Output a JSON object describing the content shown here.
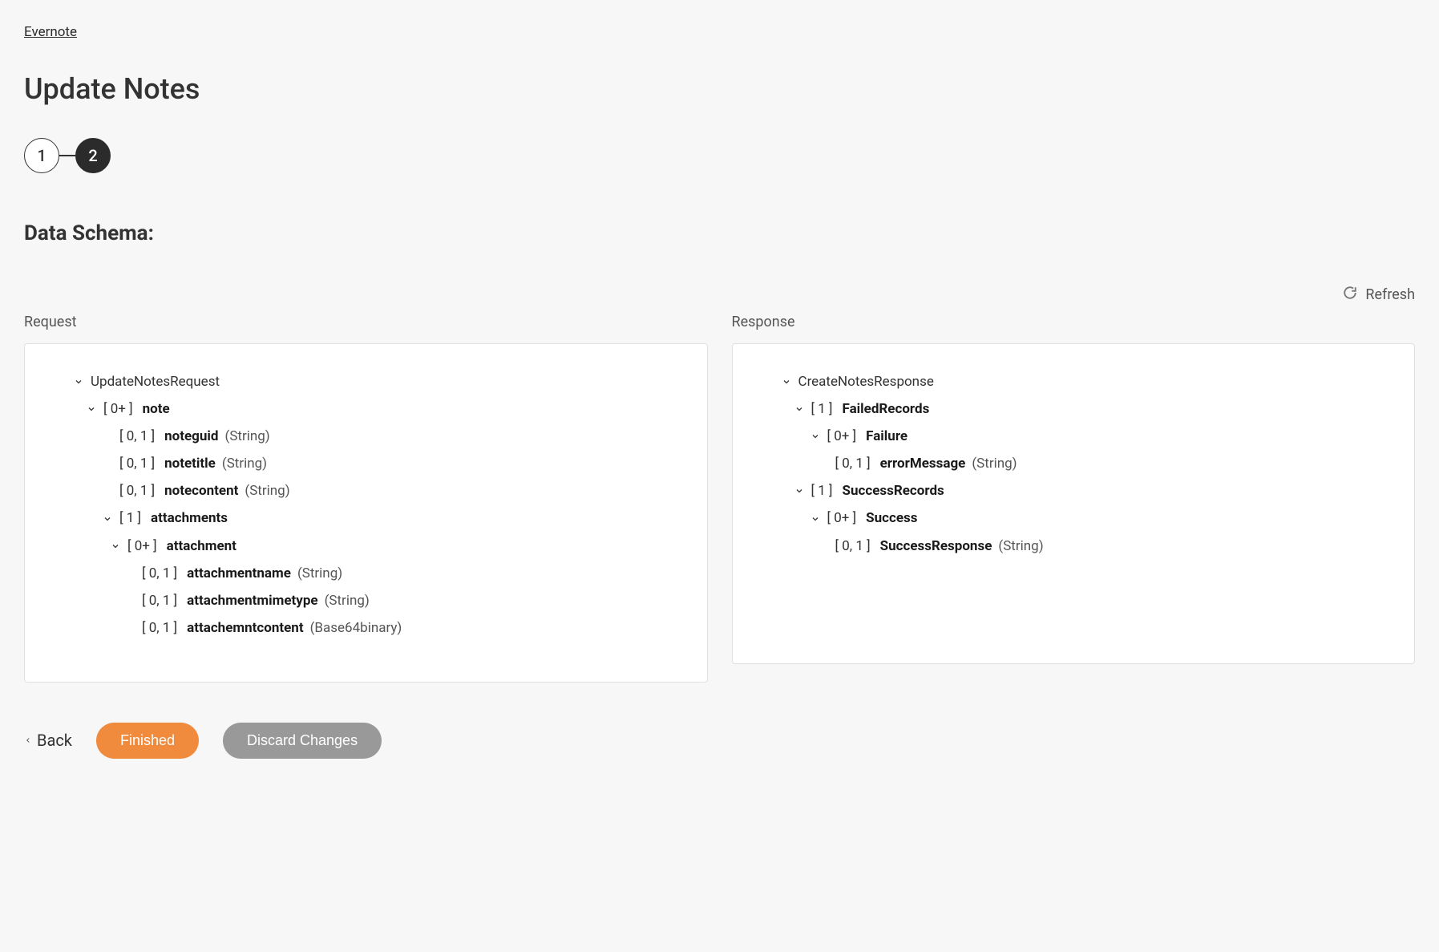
{
  "breadcrumb": "Evernote",
  "page_title": "Update Notes",
  "stepper": {
    "step1": "1",
    "step2": "2"
  },
  "section_title": "Data Schema:",
  "refresh_label": "Refresh",
  "request": {
    "label": "Request",
    "root": "UpdateNotesRequest",
    "note_card": "[ 0+ ]",
    "note_name": "note",
    "noteguid_card": "[ 0, 1 ]",
    "noteguid_name": "noteguid",
    "noteguid_type": "(String)",
    "notetitle_card": "[ 0, 1 ]",
    "notetitle_name": "notetitle",
    "notetitle_type": "(String)",
    "notecontent_card": "[ 0, 1 ]",
    "notecontent_name": "notecontent",
    "notecontent_type": "(String)",
    "attachments_card": "[ 1 ]",
    "attachments_name": "attachments",
    "attachment_card": "[ 0+ ]",
    "attachment_name": "attachment",
    "attachmentname_card": "[ 0, 1 ]",
    "attachmentname_name": "attachmentname",
    "attachmentname_type": "(String)",
    "attachmentmimetype_card": "[ 0, 1 ]",
    "attachmentmimetype_name": "attachmentmimetype",
    "attachmentmimetype_type": "(String)",
    "attachemntcontent_card": "[ 0, 1 ]",
    "attachemntcontent_name": "attachemntcontent",
    "attachemntcontent_type": "(Base64binary)"
  },
  "response": {
    "label": "Response",
    "root": "CreateNotesResponse",
    "failedrecords_card": "[ 1 ]",
    "failedrecords_name": "FailedRecords",
    "failure_card": "[ 0+ ]",
    "failure_name": "Failure",
    "errormessage_card": "[ 0, 1 ]",
    "errormessage_name": "errorMessage",
    "errormessage_type": "(String)",
    "successrecords_card": "[ 1 ]",
    "successrecords_name": "SuccessRecords",
    "success_card": "[ 0+ ]",
    "success_name": "Success",
    "successresponse_card": "[ 0, 1 ]",
    "successresponse_name": "SuccessResponse",
    "successresponse_type": "(String)"
  },
  "footer": {
    "back": "Back",
    "finished": "Finished",
    "discard": "Discard Changes"
  }
}
